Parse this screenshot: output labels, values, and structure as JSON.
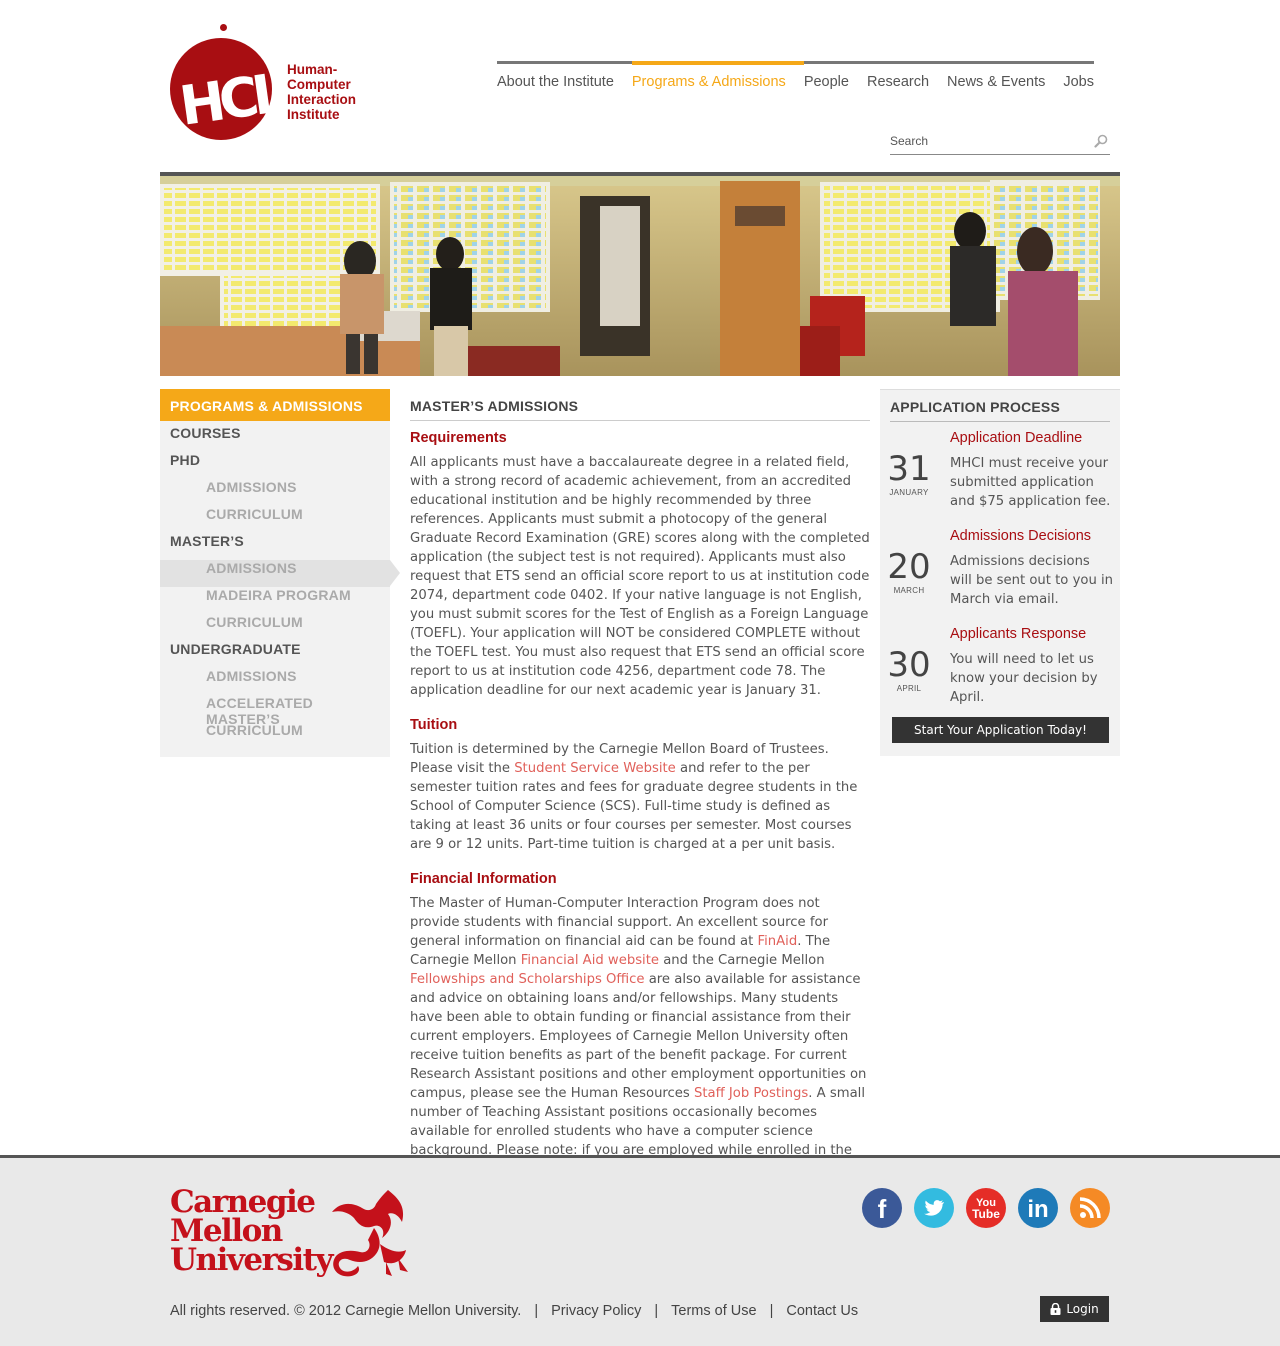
{
  "logo": {
    "letters": "HCI!",
    "lines": [
      "Human-",
      "Computer",
      "Interaction",
      "Institute"
    ]
  },
  "nav": {
    "items": [
      {
        "label": "About the Institute",
        "active": false
      },
      {
        "label": "Programs & Admissions",
        "active": true
      },
      {
        "label": "People",
        "active": false
      },
      {
        "label": "Research",
        "active": false
      },
      {
        "label": "News & Events",
        "active": false
      },
      {
        "label": "Jobs",
        "active": false
      }
    ]
  },
  "search": {
    "placeholder": "Search",
    "icon": "search-icon"
  },
  "sidebar": {
    "title": "PROGRAMS & ADMISSIONS",
    "items": [
      {
        "label": "COURSES",
        "level": 0
      },
      {
        "label": "PHD",
        "level": 0
      },
      {
        "label": "ADMISSIONS",
        "level": 1
      },
      {
        "label": "CURRICULUM",
        "level": 1
      },
      {
        "label": "MASTER’S",
        "level": 0
      },
      {
        "label": "ADMISSIONS",
        "level": 1,
        "current": true
      },
      {
        "label": "MADEIRA PROGRAM",
        "level": 1
      },
      {
        "label": "CURRICULUM",
        "level": 1
      },
      {
        "label": "UNDERGRADUATE",
        "level": 0
      },
      {
        "label": "ADMISSIONS",
        "level": 1
      },
      {
        "label": "ACCELERATED MASTER’S",
        "level": 1
      },
      {
        "label": "CURRICULUM",
        "level": 1
      }
    ]
  },
  "main": {
    "title": "MASTER’S ADMISSIONS",
    "requirements": {
      "heading": "Requirements",
      "text": "All applicants must have a baccalaureate degree in a related field, with a strong record of academic achievement, from an accredited educational institution and be highly recommended by three references. Applicants must submit a photocopy of the general Graduate Record Examination (GRE) scores along with the completed application (the subject test is not required). Applicants must also request that ETS send an official score report to us at institution code 2074, department code 0402. If your native language is not English, you must submit scores for the Test of English as a Foreign Language (TOEFL). Your application will NOT be considered COMPLETE without the TOEFL test.  You must also request that ETS send an official score report to us at institution code 4256, department code 78. The application deadline for our next academic year is January 31."
    },
    "tuition": {
      "heading": "Tuition",
      "text_1": "Tuition is determined by the Carnegie Mellon Board of Trustees. Please visit the ",
      "link_1": "Student Service Website",
      "text_2": " and refer to the per semester tuition rates and fees for graduate degree students in the School of Computer Science (SCS). Full-time study is defined as taking at least 36 units or four courses per semester. Most courses are 9 or 12 units. Part-time tuition is charged at a per unit basis."
    },
    "financial": {
      "heading": "Financial Information",
      "text_1": "The Master of Human-Computer Interaction Program does not provide students with financial support. An excellent source for general information on financial aid can be found at ",
      "link_1": "FinAid",
      "text_2": ". The Carnegie Mellon ",
      "link_2": "Financial Aid website",
      "text_3": " and the Carnegie Mellon ",
      "link_3": "Fellowships and Scholarships Office",
      "text_4": " are also available for assistance and advice on obtaining loans and/or fellowships. Many students have been able to obtain funding or financial assistance from their current employers. Employees of Carnegie Mellon University often receive tuition benefits as part of the benefit package. For current Research Assistant positions and other employment opportunities on campus, please see the Human Resources ",
      "link_4": "Staff Job Postings",
      "text_5": ". A small number of Teaching Assistant positions occasionally becomes available for enrolled students who have a computer science background. Please note: if you are employed while enrolled in the Masters program, the length of your program will be most"
    }
  },
  "application": {
    "title": "APPLICATION PROCESS",
    "steps": [
      {
        "day": "31",
        "month": "JANUARY",
        "heading": "Application Deadline",
        "text": "MHCI must receive your submitted application and $75 application fee."
      },
      {
        "day": "20",
        "month": "MARCH",
        "heading": "Admissions Decisions",
        "text": "Admissions decisions will be sent out to you in March via email."
      },
      {
        "day": "30",
        "month": "APRIL",
        "heading": "Applicants Response",
        "text": "You will need to let us know your decision by April."
      }
    ],
    "button": "Start Your Application Today!"
  },
  "footer": {
    "cmu_lines": [
      "Carnegie",
      "Mellon",
      "University"
    ],
    "social": [
      "facebook-icon",
      "twitter-icon",
      "youtube-icon",
      "linkedin-icon",
      "rss-icon"
    ],
    "youtube_text": [
      "You",
      "Tube"
    ],
    "linkedin_text": "in",
    "facebook_text": "f",
    "copyright": "All rights reserved. © 2012 Carnegie Mellon University.",
    "separator": "|",
    "links": [
      "Privacy Policy",
      "Terms of Use",
      "Contact Us"
    ],
    "login": "Login",
    "colors": {
      "facebook": "#3b5998",
      "twitter": "#33bbe0",
      "youtube": "#e52d27",
      "linkedin": "#1e7ab8",
      "rss": "#f58a25",
      "cmu_red": "#c4111b",
      "accent": "#f5a818",
      "hci_red": "#a80e12"
    }
  }
}
